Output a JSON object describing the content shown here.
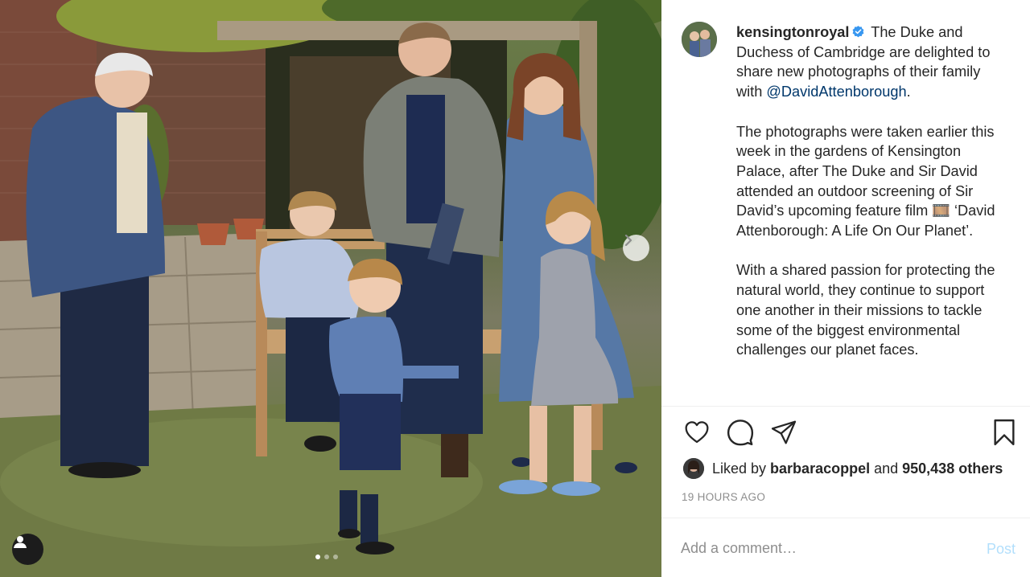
{
  "post": {
    "username": "kensingtonroyal",
    "caption_intro": " The Duke and Duchess of Cambridge are delighted to share new photographs of their family with ",
    "mention": "@DavidAttenborough",
    "caption_after_mention": ".",
    "paragraph_2": "The photographs were taken earlier this week in the gardens of Kensington Palace, after The Duke and Sir David attended an outdoor screening of Sir David’s upcoming feature film 🎞️ ‘David Attenborough: A Life On Our Planet’.",
    "paragraph_3": "With a shared passion for protecting the natural world, they continue to support one another in their missions to tackle some of the biggest environmental challenges our planet faces."
  },
  "likes": {
    "prefix": "Liked by ",
    "user": "barbaracoppel",
    "joiner": " and ",
    "others": "950,438 others"
  },
  "timestamp": "19 HOURS AGO",
  "comment": {
    "placeholder": "Add a comment…",
    "post_label": "Post"
  },
  "carousel": {
    "slide_count": 3,
    "active_index": 0
  },
  "icons": {
    "verified": "verified-badge-icon",
    "like": "heart-icon",
    "comment": "comment-bubble-icon",
    "share": "paper-plane-icon",
    "save": "bookmark-icon",
    "next": "chevron-right-icon",
    "tag": "user-tag-icon"
  },
  "colors": {
    "verified": "#3897f0",
    "mention": "#00376b",
    "muted": "#8e8e8e",
    "post_disabled": "#b2dffc"
  }
}
